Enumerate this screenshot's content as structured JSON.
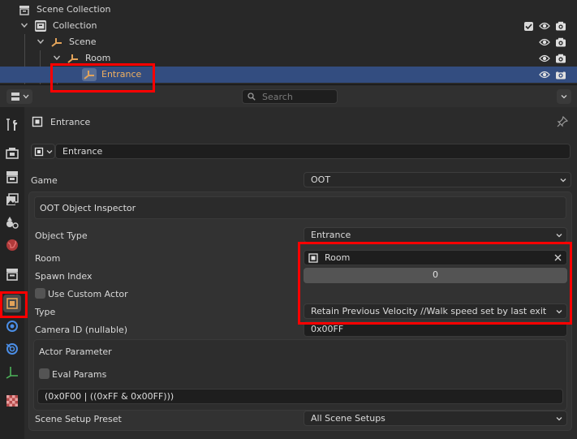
{
  "outliner": {
    "rows": [
      {
        "label": "Scene Collection"
      },
      {
        "label": "Collection"
      },
      {
        "label": "Scene"
      },
      {
        "label": "Room"
      },
      {
        "label": "Entrance"
      }
    ]
  },
  "header": {
    "search_placeholder": "Search"
  },
  "object_header": {
    "title": "Entrance",
    "name_value": "Entrance"
  },
  "game": {
    "label": "Game",
    "value": "OOT"
  },
  "inspector": {
    "title": "OOT Object Inspector",
    "object_type": {
      "label": "Object Type",
      "value": "Entrance"
    },
    "room": {
      "label": "Room",
      "value": "Room"
    },
    "spawn_index": {
      "label": "Spawn Index",
      "value": "0"
    },
    "use_custom_actor": {
      "label": "Use Custom Actor",
      "checked": false
    },
    "type": {
      "label": "Type",
      "value": "Retain Previous Velocity //Walk speed set by last exit"
    },
    "camera_id": {
      "label": "Camera ID (nullable)",
      "value": "0x00FF"
    },
    "actor_parameter": {
      "title": "Actor Parameter",
      "eval_params": {
        "label": "Eval Params",
        "checked": false
      },
      "expression": "(0x0F00 | ((0xFF & 0x00FF)))"
    },
    "scene_setup_preset": {
      "label": "Scene Setup Preset",
      "value": "All Scene Setups"
    }
  },
  "colors": {
    "highlight": "#ff0000",
    "selection": "#334d80",
    "object_orange": "#e2a35a"
  }
}
